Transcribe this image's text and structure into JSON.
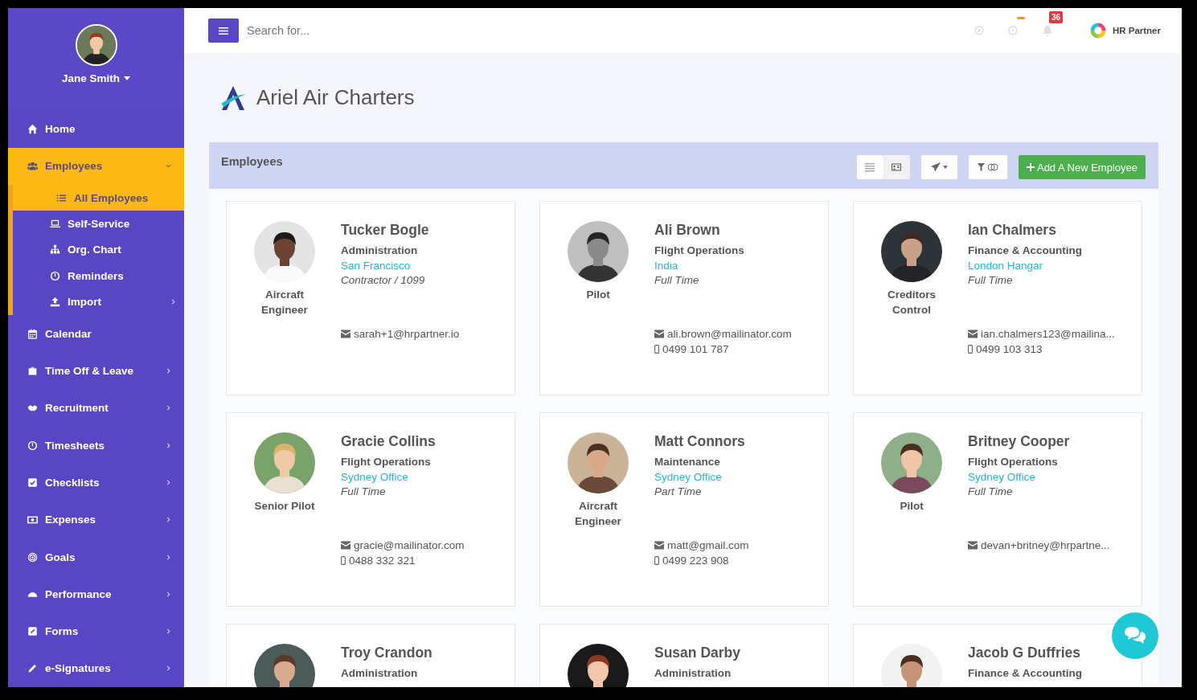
{
  "user": {
    "name": "Jane Smith"
  },
  "topbar": {
    "search": {
      "placeholder": "Search for..."
    },
    "notifications": {
      "count": "36"
    },
    "brand": "HR Partner"
  },
  "nav": [
    {
      "label": "Home",
      "selected": false
    },
    {
      "label": "Employees",
      "selected": true,
      "expanded": true,
      "children": [
        {
          "label": "All Employees",
          "selected": true
        },
        {
          "label": "Self-Service",
          "selected": false
        },
        {
          "label": "Org. Chart",
          "selected": false
        },
        {
          "label": "Reminders",
          "selected": false
        },
        {
          "label": "Import",
          "selected": false,
          "expanded": false
        }
      ]
    },
    {
      "label": "Calendar",
      "selected": false
    },
    {
      "label": "Time Off & Leave",
      "selected": false,
      "expanded": false
    },
    {
      "label": "Recruitment",
      "selected": false,
      "expanded": false
    },
    {
      "label": "Timesheets",
      "selected": false,
      "expanded": false
    },
    {
      "label": "Checklists",
      "selected": false,
      "expanded": false
    },
    {
      "label": "Expenses",
      "selected": false,
      "expanded": false
    },
    {
      "label": "Goals",
      "selected": false,
      "expanded": false
    },
    {
      "label": "Performance",
      "selected": false,
      "expanded": false
    },
    {
      "label": "Forms",
      "selected": false,
      "expanded": false
    },
    {
      "label": "e-Signatures",
      "selected": false,
      "expanded": false
    }
  ],
  "company": {
    "name": "Ariel Air Charters"
  },
  "panel": {
    "title": "Employees",
    "view_modes": [
      {
        "selected": false
      },
      {
        "selected": true
      }
    ],
    "add_button": "Add A New Employee"
  },
  "employees": [
    {
      "name": "Tucker Bogle",
      "department": "Administration",
      "location": "San Francisco",
      "employment_type": "Contractor / 1099",
      "title": "Aircraft Engineer",
      "email": "sarah+1@hrpartner.io"
    },
    {
      "name": "Ali Brown",
      "department": "Flight Operations",
      "location": "India",
      "employment_type": "Full Time",
      "title": "Pilot",
      "email": "ali.brown@mailinator.com",
      "phone": "0499 101 787"
    },
    {
      "name": "Ian Chalmers",
      "department": "Finance & Accounting",
      "location": "London Hangar",
      "employment_type": "Full Time",
      "title": "Creditors Control",
      "email": "ian.chalmers123@mailina...",
      "phone": "0499 103 313"
    },
    {
      "name": "Gracie Collins",
      "department": "Flight Operations",
      "location": "Sydney Office",
      "employment_type": "Full Time",
      "title": "Senior Pilot",
      "email": "gracie@mailinator.com",
      "phone": "0488 332 321"
    },
    {
      "name": "Matt Connors",
      "department": "Maintenance",
      "location": "Sydney Office",
      "employment_type": "Part Time",
      "title": "Aircraft Engineer",
      "email": "matt@gmail.com",
      "phone": "0499 223 908"
    },
    {
      "name": "Britney Cooper",
      "department": "Flight Operations",
      "location": "Sydney Office",
      "employment_type": "Full Time",
      "title": "Pilot",
      "email": "devan+britney@hrpartne..."
    },
    {
      "name": "Troy Crandon",
      "department": "Administration"
    },
    {
      "name": "Susan Darby",
      "department": "Administration"
    },
    {
      "name": "Jacob G Duffries",
      "department": "Finance & Accounting"
    }
  ]
}
